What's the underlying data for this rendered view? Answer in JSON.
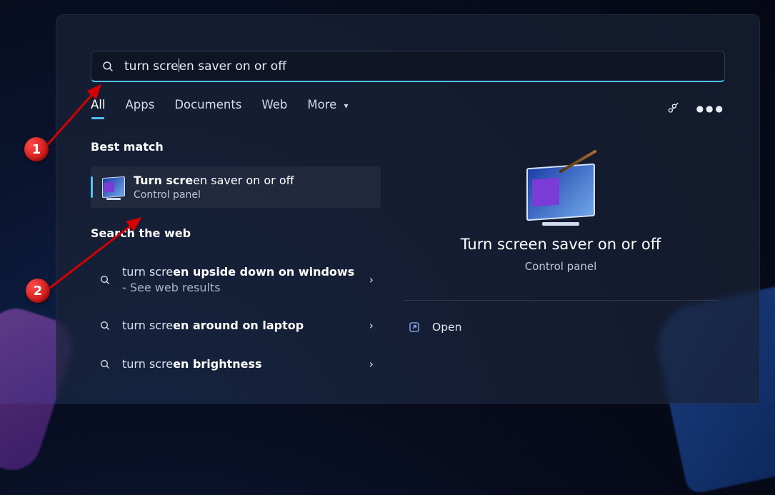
{
  "search": {
    "query_prefix": "turn scre",
    "query_rest": "en saver on or off"
  },
  "tabs": {
    "all": "All",
    "apps": "Apps",
    "documents": "Documents",
    "web": "Web",
    "more": "More"
  },
  "sections": {
    "best_match": "Best match",
    "search_web": "Search the web"
  },
  "best_match": {
    "title_prefix": "Turn scre",
    "title_rest": "en saver on or off",
    "subtitle": "Control panel"
  },
  "web_results": {
    "item1_pre": "turn scre",
    "item1_bold": "en upside down on windows",
    "item1_hint": " - See web results",
    "item2_pre": "turn scre",
    "item2_bold": "en around on laptop",
    "item3_pre": "turn scre",
    "item3_bold": "en brightness"
  },
  "detail": {
    "title": "Turn screen saver on or off",
    "subtitle": "Control panel",
    "action_open": "Open"
  },
  "annotations": {
    "one": "1",
    "two": "2"
  }
}
